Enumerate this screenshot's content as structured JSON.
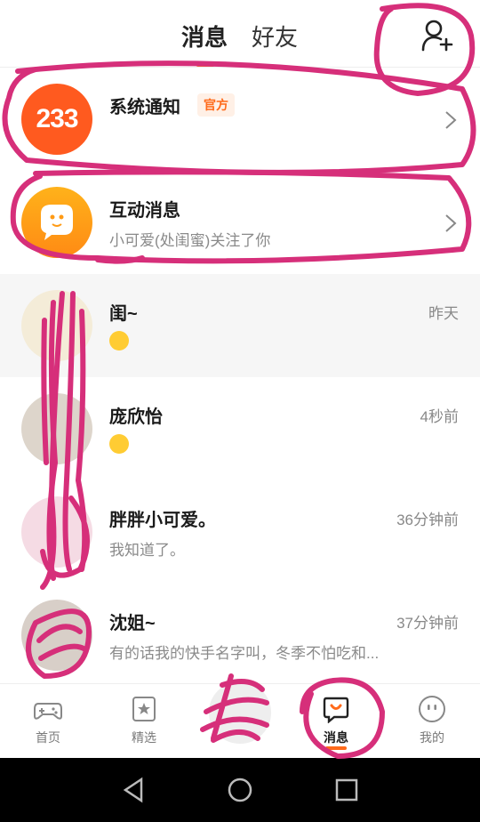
{
  "header": {
    "tabs": [
      {
        "label": "消息"
      },
      {
        "label": "好友"
      }
    ]
  },
  "system_row": {
    "avatar_text": "233",
    "title": "系统通知",
    "badge": "官方"
  },
  "activity_row": {
    "title": "互动消息",
    "subtitle": "小可爱(处闺蜜)关注了你"
  },
  "chats": [
    {
      "name": "闺~",
      "time": "昨天",
      "preview": ""
    },
    {
      "name": "庞欣怡",
      "time": "4秒前",
      "preview": ""
    },
    {
      "name": "胖胖小可爱。",
      "time": "36分钟前",
      "preview": "我知道了。"
    },
    {
      "name": "沈姐~",
      "time": "37分钟前",
      "preview": "有的话我的快手名字叫，冬季不怕吃和..."
    }
  ],
  "bottom_nav": [
    {
      "label": "首页",
      "icon": "gamepad-icon"
    },
    {
      "label": "精选",
      "icon": "star-card-icon"
    },
    {
      "label": "",
      "icon": "avatar"
    },
    {
      "label": "消息",
      "icon": "message-bubble-icon"
    },
    {
      "label": "我的",
      "icon": "face-icon"
    }
  ],
  "colors": {
    "accent": "#ff6a1a",
    "annotation": "#d62f7a"
  }
}
